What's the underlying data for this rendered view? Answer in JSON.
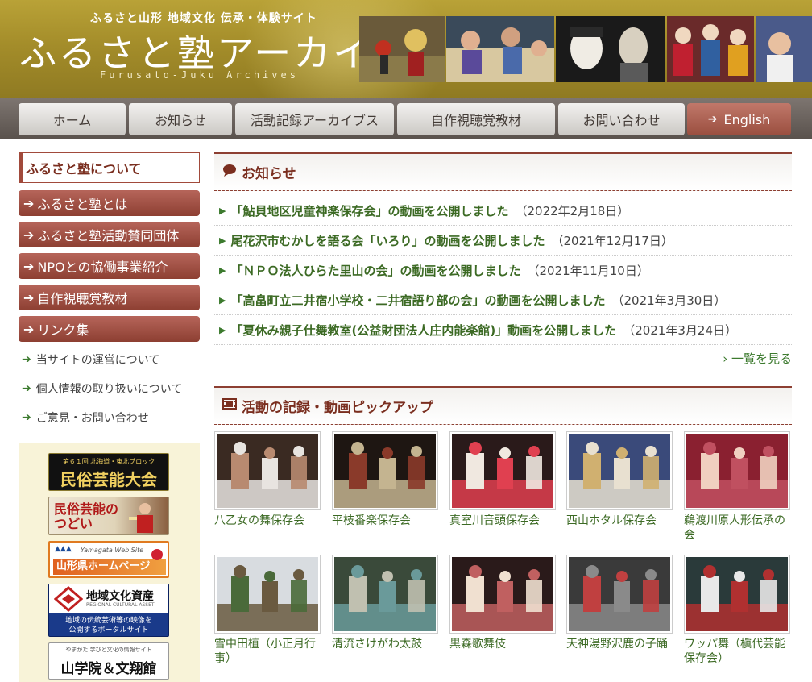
{
  "header": {
    "tagline": "ふるさと山形 地域文化 伝承・体験サイト",
    "title": "ふるさと塾アーカイブス",
    "subtitle": "Furusato-Juku Archives"
  },
  "nav": {
    "items": [
      {
        "label": "ホーム"
      },
      {
        "label": "お知らせ"
      },
      {
        "label": "活動記録アーカイブス"
      },
      {
        "label": "自作視聴覚教材"
      },
      {
        "label": "お問い合わせ"
      },
      {
        "label": "English"
      }
    ]
  },
  "sidebar": {
    "heading": "ふるさと塾について",
    "items": [
      {
        "label": "ふるさと塾とは"
      },
      {
        "label": "ふるさと塾活動賛同団体"
      },
      {
        "label": "NPOとの協働事業紹介"
      },
      {
        "label": "自作視聴覚教材"
      },
      {
        "label": "リンク集"
      }
    ],
    "links": [
      {
        "label": "当サイトの運営について"
      },
      {
        "label": "個人情報の取り扱いについて"
      },
      {
        "label": "ご意見・お問い合わせ"
      }
    ],
    "banners": {
      "minzoku_top": "第６１回 北海道・東北ブロック",
      "minzoku_main": "民俗芸能大会",
      "tsudoi": "民俗芸能のつどい",
      "yamagata_small": "Yamagata Web Site",
      "yamagata_main": "山形県ホームページ",
      "chiiki_main": "地域文化資産",
      "chiiki_en": "REGIONAL CULTURAL ASSET",
      "chiiki_desc1": "地域の伝統芸術等の映像を",
      "chiiki_desc2": "公開するポータルサイト",
      "gakugei_top": "やまがた 学びと文化の情報サイト",
      "gakugei_main": "山学院＆文翔館"
    }
  },
  "news": {
    "heading": "お知らせ",
    "items": [
      {
        "title": "「鮎貝地区児童神楽保存会」の動画を公開しました",
        "date": "（2022年2月18日）"
      },
      {
        "title": "尾花沢市むかしを語る会「いろり」の動画を公開しました",
        "date": "（2021年12月17日）"
      },
      {
        "title": "「ＮＰＯ法人ひらた里山の会」の動画を公開しました",
        "date": "（2021年11月10日）"
      },
      {
        "title": "「高畠町立二井宿小学校・二井宿語り部の会」の動画を公開しました",
        "date": "（2021年3月30日）"
      },
      {
        "title": "「夏休み親子仕舞教室(公益財団法人庄内能楽館)」動画を公開しました",
        "date": "（2021年3月24日）"
      }
    ],
    "more": "› 一覧を見る"
  },
  "pickup": {
    "heading": "活動の記録・動画ピックアップ",
    "items": [
      {
        "caption": "八乙女の舞保存会",
        "colors": [
          "#3a2a22",
          "#e8e4e0",
          "#b88a70"
        ]
      },
      {
        "caption": "平枝番楽保存会",
        "colors": [
          "#1e1612",
          "#c4b490",
          "#8a3a2a"
        ]
      },
      {
        "caption": "真室川音頭保存会",
        "colors": [
          "#2a1a1a",
          "#e04050",
          "#f0e8e0"
        ]
      },
      {
        "caption": "西山ホタル保存会",
        "colors": [
          "#3a4a7a",
          "#e8e0d0",
          "#d0b070"
        ]
      },
      {
        "caption": "鵜渡川原人形伝承の会",
        "colors": [
          "#8a2030",
          "#c05060",
          "#f0d0c0"
        ]
      },
      {
        "caption": "雪中田植（小正月行事）",
        "colors": [
          "#d8dce0",
          "#6a5a40",
          "#4a6a3a"
        ]
      },
      {
        "caption": "清流さけがわ太鼓",
        "colors": [
          "#3a4a3a",
          "#6a9a9a",
          "#c0c0b0"
        ]
      },
      {
        "caption": "黒森歌舞伎",
        "colors": [
          "#2a1a1a",
          "#c06060",
          "#f0e0d0"
        ]
      },
      {
        "caption": "天神湯野沢鹿の子踊",
        "colors": [
          "#3a3a3a",
          "#8a8a8a",
          "#c04040"
        ]
      },
      {
        "caption": "ワッパ舞（槇代芸能保存会）",
        "colors": [
          "#2a3a3a",
          "#b03030",
          "#e8e8e8"
        ]
      }
    ]
  }
}
